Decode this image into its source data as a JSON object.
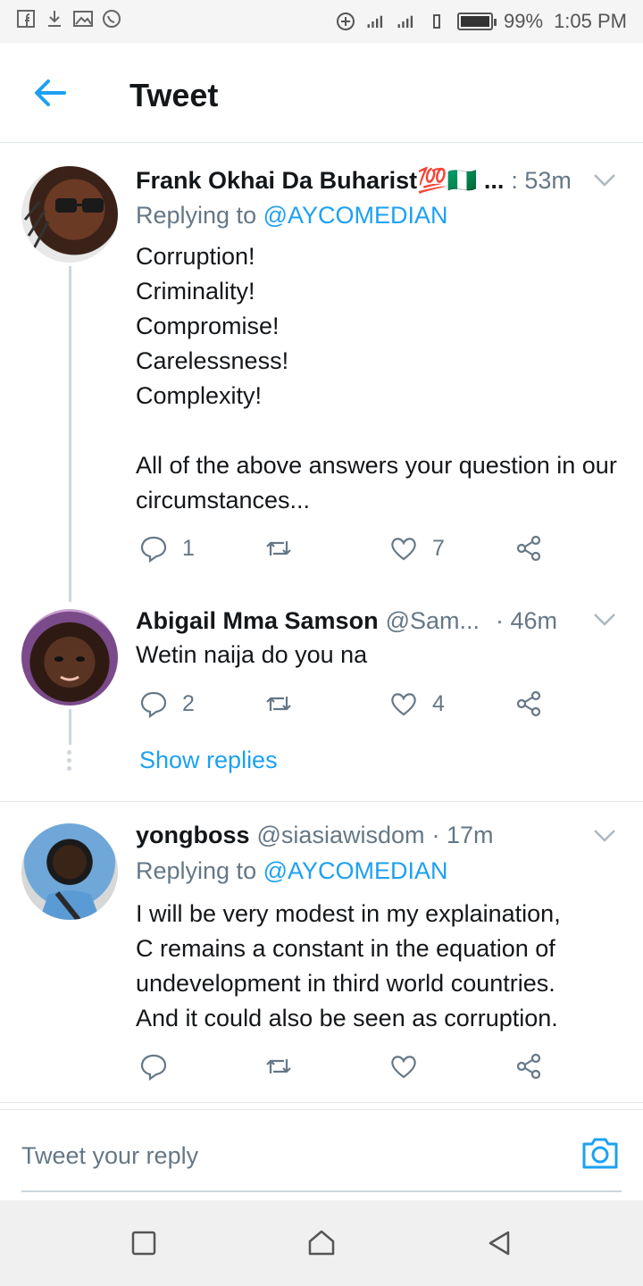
{
  "status_bar": {
    "battery_text": "99%",
    "time": "1:05 PM",
    "battery_level": 0.99,
    "left_icons": [
      "facebook-icon",
      "download-icon",
      "image-icon",
      "whatsapp-icon"
    ],
    "right_icons": [
      "data-saver-icon",
      "signal-icon",
      "signal-h-icon",
      "vibrate-icon",
      "battery-icon"
    ]
  },
  "header": {
    "title": "Tweet",
    "back_icon": "arrow-left-icon"
  },
  "tweets": [
    {
      "name": "Frank Okhai Da Buharist💯🇳🇬 ...",
      "time": ": 53m",
      "replying_prefix": "Replying to ",
      "replying_to": "@AYCOMEDIAN",
      "body": "Corruption!\nCriminality!\nCompromise!\nCarelessness!\nComplexity!\n\nAll of the above answers your question in our circumstances...",
      "replies": "1",
      "retweets": "",
      "likes": "7"
    },
    {
      "name": "Abigail Mma Samson",
      "handle": "@Sam...",
      "time": "· 46m",
      "body": "Wetin naija do you na",
      "replies": "2",
      "retweets": "",
      "likes": "4"
    },
    {
      "name": "yongboss",
      "handle": "@siasiawisdom",
      "time": "· 17m",
      "replying_prefix": "Replying to ",
      "replying_to": "@AYCOMEDIAN",
      "body": "I will be very modest in my explaination,\nC remains a constant in the equation of\nundevelopment in third world countries.\nAnd it could also be seen as corruption.",
      "replies": "",
      "retweets": "",
      "likes": ""
    }
  ],
  "show_replies": "Show replies",
  "composer": {
    "placeholder": "Tweet your reply",
    "camera_icon": "camera-icon"
  },
  "nav": {
    "icons": [
      "recent-apps-icon",
      "home-icon",
      "back-triangle-icon"
    ]
  },
  "colors": {
    "accent": "#1da1f2",
    "text": "#14171a",
    "secondary": "#657786",
    "divider": "#e1e8ed"
  }
}
